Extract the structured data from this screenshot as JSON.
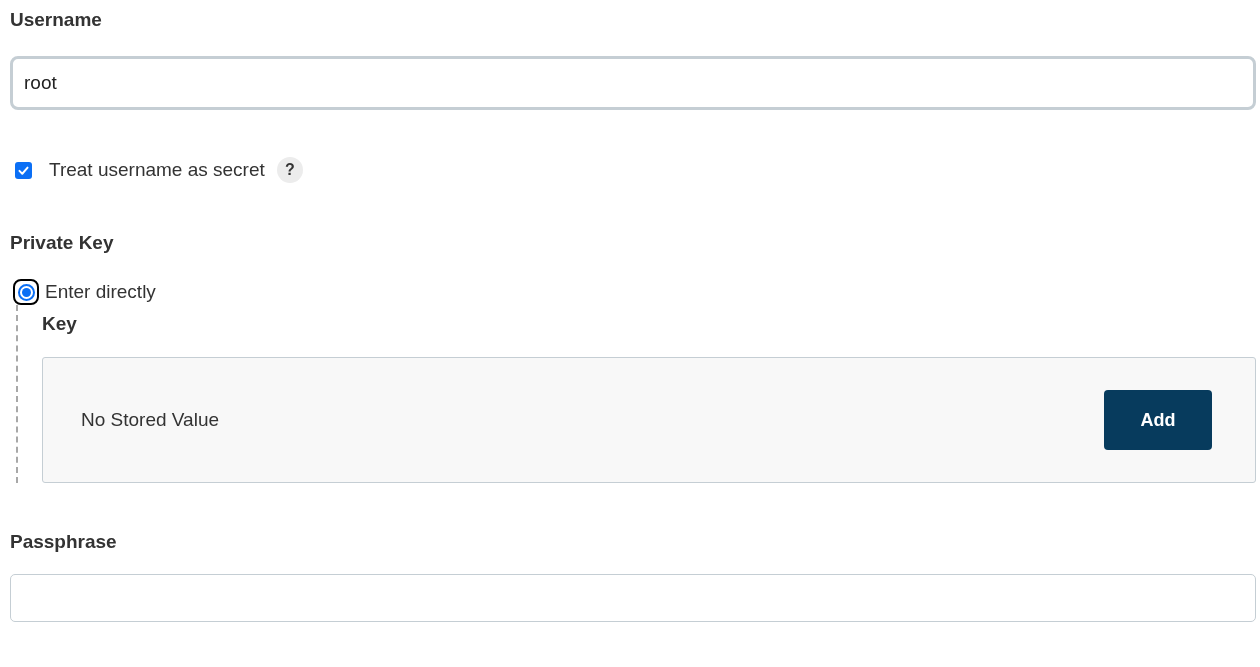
{
  "username": {
    "label": "Username",
    "value": "root",
    "focused": true
  },
  "secret_option": {
    "label": "Treat username as secret",
    "checked": true,
    "help": "?"
  },
  "private_key": {
    "label": "Private Key",
    "options": [
      {
        "label": "Enter directly",
        "selected": true,
        "focused": true,
        "key": {
          "label": "Key",
          "status": "No Stored Value",
          "button": "Add"
        }
      }
    ]
  },
  "passphrase": {
    "label": "Passphrase",
    "focused": false
  }
}
